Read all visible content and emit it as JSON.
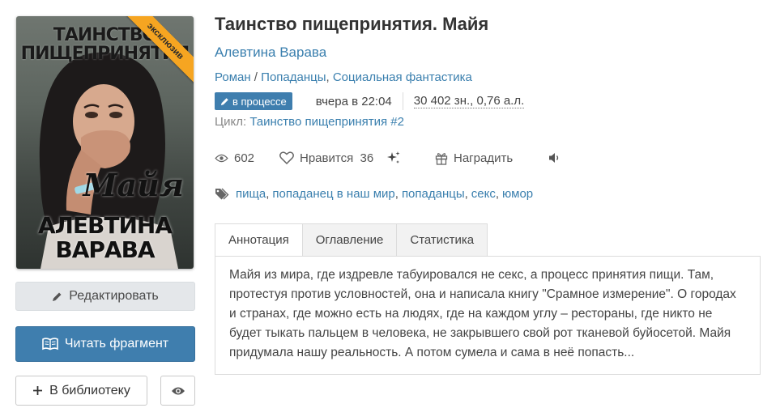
{
  "cover": {
    "ribbon": "эксклюзив",
    "title_line1": "ТАИНСТВО",
    "title_line2": "ПИЩЕПРИНЯТИЯ",
    "name": "Майя",
    "author_line1": "АЛЕВТИНА",
    "author_line2": "ВАРАВА"
  },
  "buttons": {
    "edit": "Редактировать",
    "read": "Читать фрагмент",
    "library": "В библиотеку"
  },
  "book": {
    "title": "Таинство пищепринятия. Майя",
    "author": "Алевтина Варава",
    "genres": [
      "Роман",
      "Попаданцы",
      "Социальная фантастика"
    ],
    "genre_sep": " / ",
    "genre_comma": ", ",
    "status": "в процессе",
    "updated": "вчера в 22:04",
    "size": "30 402 зн., 0,76 а.л.",
    "cycle_label": "Цикл:",
    "cycle_name": "Таинство пищепринятия #2"
  },
  "actions": {
    "views": "602",
    "likes_label": "Нравится",
    "likes_count": "36",
    "award": "Наградить"
  },
  "tags": [
    "пища",
    "попаданец в наш мир",
    "попаданцы",
    "секс",
    "юмор"
  ],
  "tabs": [
    "Аннотация",
    "Оглавление",
    "Статистика"
  ],
  "annotation": "Майя из мира, где издревле табуировался не секс, а процесс принятия пищи. Там, протестуя против условностей, она и написала книгу \"Срамное измерение\". О городах и странах, где можно есть на людях, где на каждом углу – рестораны, где никто не будет тыкать пальцем в человека, не закрывшего свой рот тканевой буйосетой. Майя придумала нашу реальность. А потом сумела и сама в неё попасть...",
  "colors": {
    "accent": "#3f7eae",
    "link": "#3a7fae",
    "ribbon": "#f6a521"
  }
}
